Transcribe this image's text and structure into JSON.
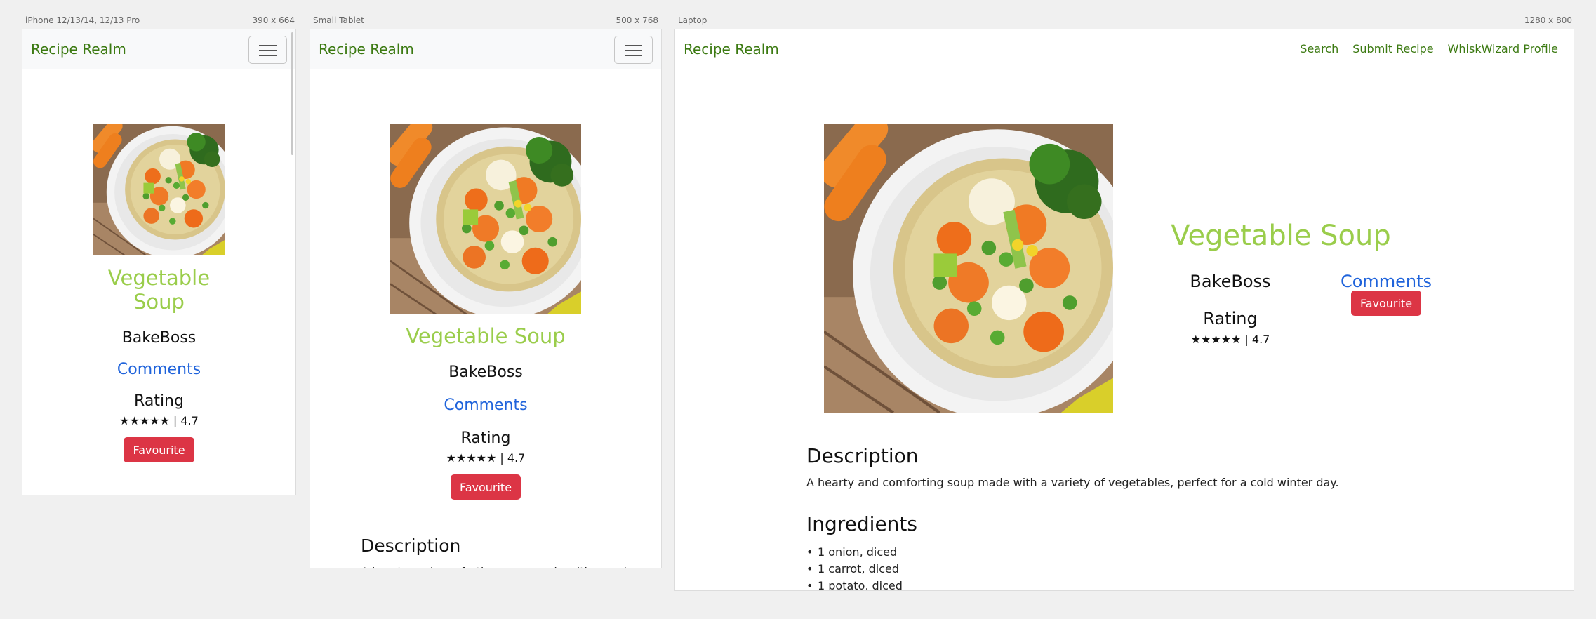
{
  "frames": {
    "phone": {
      "label": "iPhone 12/13/14, 12/13 Pro",
      "size": "390 x 664"
    },
    "tablet": {
      "label": "Small Tablet",
      "size": "500 x 768"
    },
    "laptop": {
      "label": "Laptop",
      "size": "1280 x 800"
    }
  },
  "nav": {
    "brand": "Recipe Realm",
    "links": [
      "Search",
      "Submit Recipe",
      "WhiskWizard Profile"
    ]
  },
  "recipe": {
    "title": "Vegetable Soup",
    "author": "BakeBoss",
    "comments_link": "Comments",
    "rating_heading": "Rating",
    "rating_text": "★★★★★ | 4.7",
    "favourite_label": "Favourite",
    "description_heading": "Description",
    "description": "A hearty and comforting soup made with a variety of vegetables, perfect for a cold winter day.",
    "ingredients_heading": "Ingredients",
    "ingredients": [
      "1 onion, diced",
      "1 carrot, diced",
      "1 potato, diced"
    ]
  },
  "colors": {
    "brand": "#3c7a12",
    "title": "#9acd4b",
    "link": "#1f63db",
    "button": "#dc3545"
  }
}
